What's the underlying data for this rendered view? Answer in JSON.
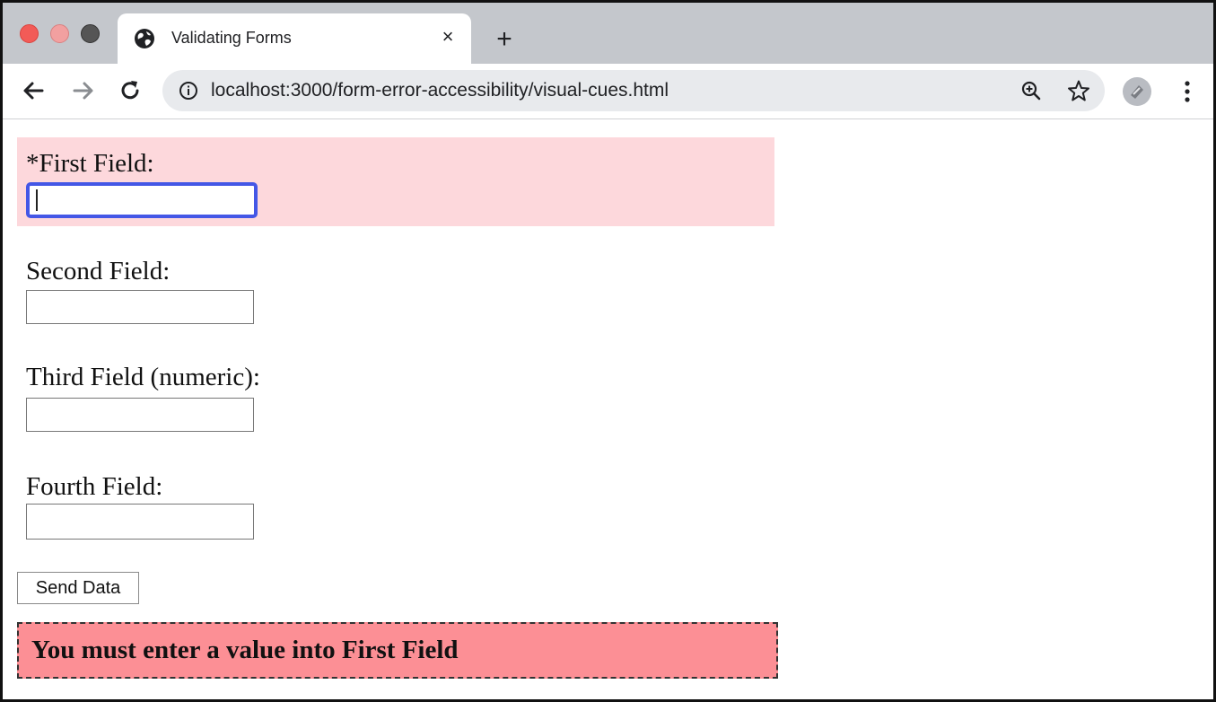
{
  "browser": {
    "tab": {
      "title": "Validating Forms",
      "close_glyph": "×",
      "favicon": "globe-icon"
    },
    "new_tab_glyph": "+",
    "address_bar": {
      "url": "localhost:3000/form-error-accessibility/visual-cues.html"
    },
    "icons": {
      "back": "arrow-left-icon",
      "forward": "arrow-right-icon",
      "reload": "reload-icon",
      "site_info": "info-icon",
      "zoom": "zoom-icon",
      "bookmark": "star-icon",
      "profile": "avatar",
      "menu": "more-vert-icon"
    }
  },
  "form": {
    "fields": [
      {
        "label": "*First Field:",
        "value": "",
        "state": "error",
        "focused": true
      },
      {
        "label": "Second Field:",
        "value": ""
      },
      {
        "label": "Third Field (numeric):",
        "value": ""
      },
      {
        "label": "Fourth Field:",
        "value": ""
      }
    ],
    "submit_label": "Send Data",
    "error_message": "You must enter a value into First Field"
  },
  "colors": {
    "error_field_background": "#fdd8dc",
    "error_summary_background": "#fc8f95",
    "focus_ring": "#4457e6"
  }
}
